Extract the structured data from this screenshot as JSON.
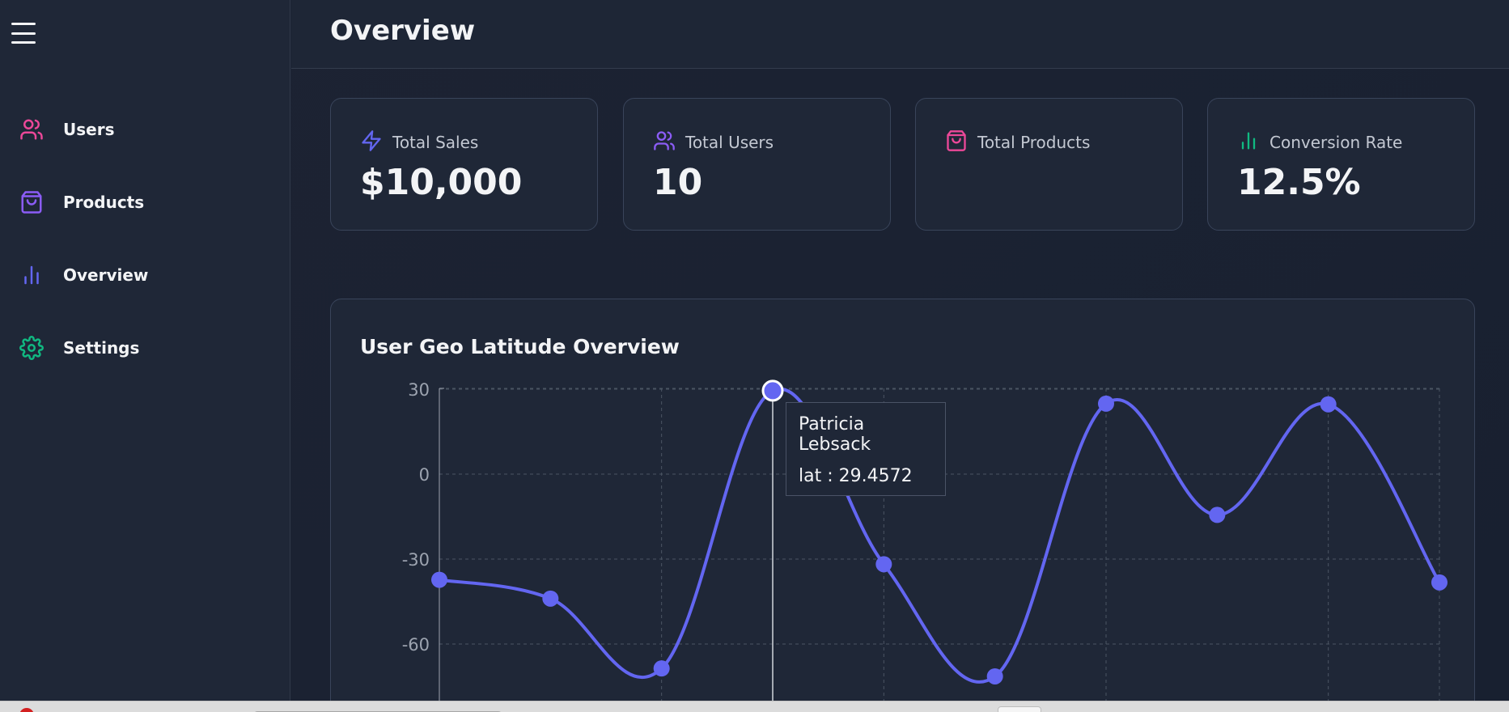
{
  "header": {
    "title": "Overview"
  },
  "sidebar": {
    "items": [
      {
        "label": "Users",
        "icon": "users-icon",
        "color": "#ec4899"
      },
      {
        "label": "Products",
        "icon": "shopping-bag-icon",
        "color": "#8b5cf6"
      },
      {
        "label": "Overview",
        "icon": "bar-chart-icon",
        "color": "#6366f1"
      },
      {
        "label": "Settings",
        "icon": "gear-icon",
        "color": "#10b981"
      }
    ]
  },
  "stats": [
    {
      "label": "Total Sales",
      "value": "$10,000",
      "icon": "zap-icon",
      "color": "#6366f1"
    },
    {
      "label": "Total Users",
      "value": "10",
      "icon": "users-icon",
      "color": "#8b5cf6"
    },
    {
      "label": "Total Products",
      "value": "",
      "icon": "shopping-bag-icon",
      "color": "#ec4899"
    },
    {
      "label": "Conversion Rate",
      "value": "12.5%",
      "icon": "bar-chart-icon",
      "color": "#10b981"
    }
  ],
  "chart": {
    "title": "User Geo Latitude Overview",
    "tooltip": {
      "name": "Patricia Lebsack",
      "value_text": "lat : 29.4572"
    }
  },
  "chart_data": {
    "type": "line",
    "title": "User Geo Latitude Overview",
    "xlabel": "",
    "ylabel": "",
    "ylim": [
      -80,
      32
    ],
    "yticks": [
      "30",
      "0",
      "-30",
      "-60"
    ],
    "ytick_values": [
      30,
      0,
      -30,
      -60
    ],
    "grid": true,
    "series": [
      {
        "values": [
          -37.3159,
          -43.9509,
          -68.6102,
          29.4572,
          -31.8129,
          -71.4197,
          24.8918,
          -14.399,
          24.6463,
          -38.2386
        ]
      }
    ],
    "active_index": 3,
    "color": "#6366f1"
  }
}
